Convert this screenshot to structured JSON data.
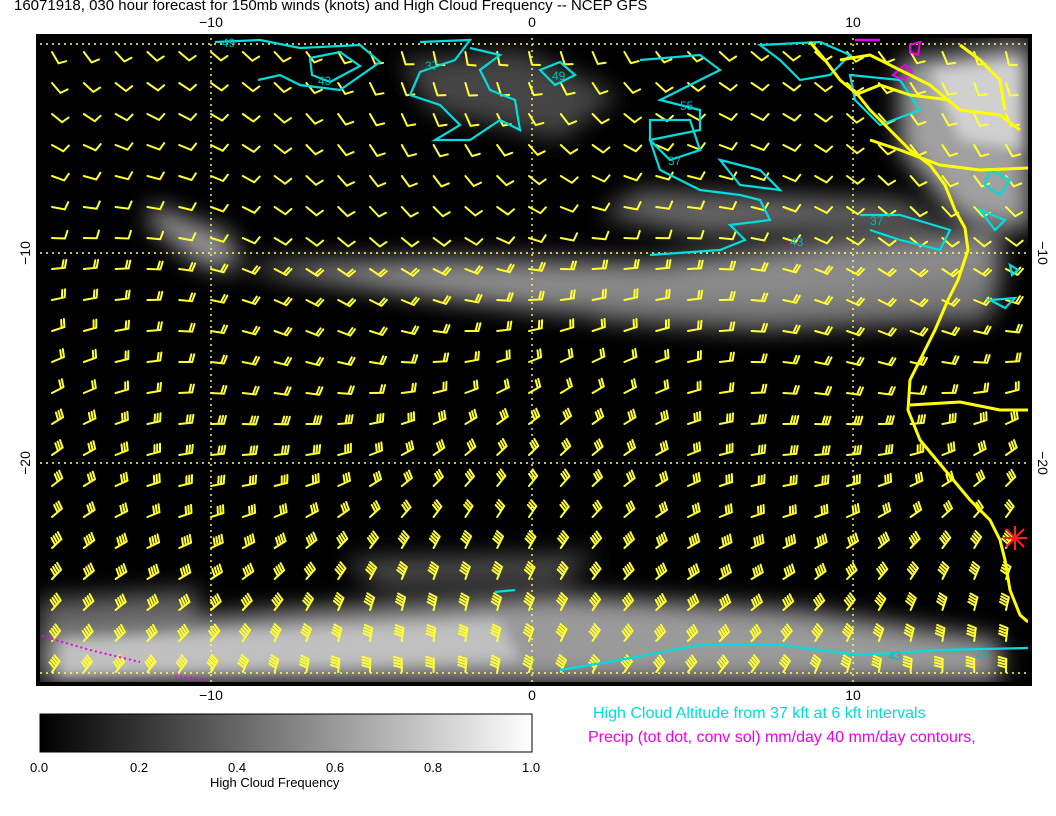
{
  "title": "16071918, 030 hour forecast for 150mb winds (knots) and High Cloud Frequency -- NCEP GFS",
  "map": {
    "x_tick_labels": [
      "−10",
      "0",
      "10"
    ],
    "y_tick_labels": [
      "−10",
      "−20"
    ],
    "contour_labels": [
      "49",
      "43",
      "37",
      "49",
      "55",
      "37",
      "43",
      "37",
      "43",
      "43"
    ]
  },
  "colorbar": {
    "title": "High Cloud Frequency",
    "tick_labels": [
      "0.0",
      "0.2",
      "0.4",
      "0.6",
      "0.8",
      "1.0"
    ]
  },
  "notes": {
    "cloud_altitude": "High Cloud Altitude from 37 kft at 6 kft intervals",
    "precip": "Precip (tot dot, conv sol) mm/day 40 mm/day contours,"
  },
  "colors": {
    "background": "#000000",
    "wind_barbs": "#ffff33",
    "gridlines": "#ffff66",
    "coastline": "#ffff00",
    "cloud_altitude_contours": "#00dddd",
    "precip_contours": "#ee00ee",
    "marker": "#ff2020"
  }
}
